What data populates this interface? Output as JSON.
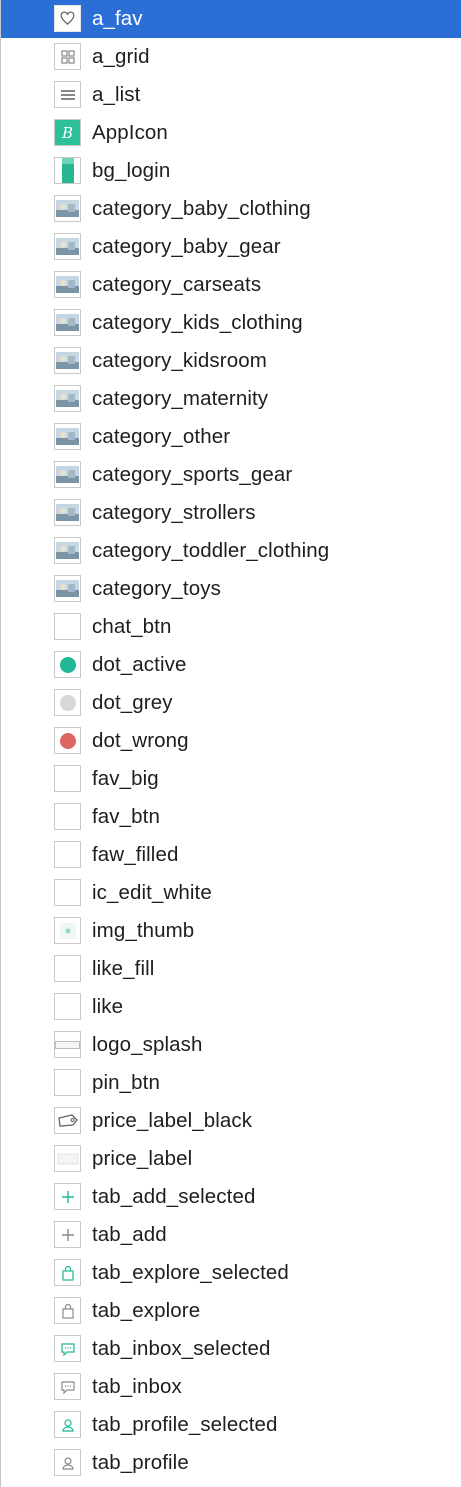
{
  "assets": [
    {
      "name": "a_fav",
      "icon": "heart-outline-icon",
      "selected": true
    },
    {
      "name": "a_grid",
      "icon": "grid-icon"
    },
    {
      "name": "a_list",
      "icon": "list-icon"
    },
    {
      "name": "AppIcon",
      "icon": "app-icon"
    },
    {
      "name": "bg_login",
      "icon": "bg-login-icon"
    },
    {
      "name": "category_baby_clothing",
      "icon": "photo-thumbnail-icon"
    },
    {
      "name": "category_baby_gear",
      "icon": "photo-thumbnail-icon"
    },
    {
      "name": "category_carseats",
      "icon": "photo-thumbnail-icon"
    },
    {
      "name": "category_kids_clothing",
      "icon": "photo-thumbnail-icon"
    },
    {
      "name": "category_kidsroom",
      "icon": "photo-thumbnail-icon"
    },
    {
      "name": "category_maternity",
      "icon": "photo-thumbnail-icon"
    },
    {
      "name": "category_other",
      "icon": "photo-thumbnail-icon"
    },
    {
      "name": "category_sports_gear",
      "icon": "photo-thumbnail-icon"
    },
    {
      "name": "category_strollers",
      "icon": "photo-thumbnail-icon"
    },
    {
      "name": "category_toddler_clothing",
      "icon": "photo-thumbnail-icon"
    },
    {
      "name": "category_toys",
      "icon": "photo-thumbnail-icon"
    },
    {
      "name": "chat_btn",
      "icon": "blank-icon"
    },
    {
      "name": "dot_active",
      "icon": "dot-icon",
      "dot_color": "#1fb896"
    },
    {
      "name": "dot_grey",
      "icon": "dot-icon",
      "dot_color": "#d8d8d8"
    },
    {
      "name": "dot_wrong",
      "icon": "dot-icon",
      "dot_color": "#e06666"
    },
    {
      "name": "fav_big",
      "icon": "blank-icon"
    },
    {
      "name": "fav_btn",
      "icon": "blank-icon"
    },
    {
      "name": "faw_filled",
      "icon": "blank-icon"
    },
    {
      "name": "ic_edit_white",
      "icon": "blank-icon"
    },
    {
      "name": "img_thumb",
      "icon": "image-thumb-icon"
    },
    {
      "name": "like_fill",
      "icon": "blank-icon"
    },
    {
      "name": "like",
      "icon": "blank-icon"
    },
    {
      "name": "logo_splash",
      "icon": "logo-splash-icon"
    },
    {
      "name": "pin_btn",
      "icon": "blank-icon"
    },
    {
      "name": "price_label_black",
      "icon": "price-tag-icon"
    },
    {
      "name": "price_label",
      "icon": "price-label-icon"
    },
    {
      "name": "tab_add_selected",
      "icon": "plus-icon",
      "accent": true
    },
    {
      "name": "tab_add",
      "icon": "plus-icon"
    },
    {
      "name": "tab_explore_selected",
      "icon": "bag-icon",
      "accent": true
    },
    {
      "name": "tab_explore",
      "icon": "bag-icon"
    },
    {
      "name": "tab_inbox_selected",
      "icon": "chat-bubble-icon",
      "accent": true
    },
    {
      "name": "tab_inbox",
      "icon": "chat-bubble-icon"
    },
    {
      "name": "tab_profile_selected",
      "icon": "person-icon",
      "accent": true
    },
    {
      "name": "tab_profile",
      "icon": "person-icon"
    }
  ],
  "colors": {
    "selection": "#2a6ed6",
    "accent": "#1fb896",
    "icon_grey": "#8a8a8a"
  }
}
